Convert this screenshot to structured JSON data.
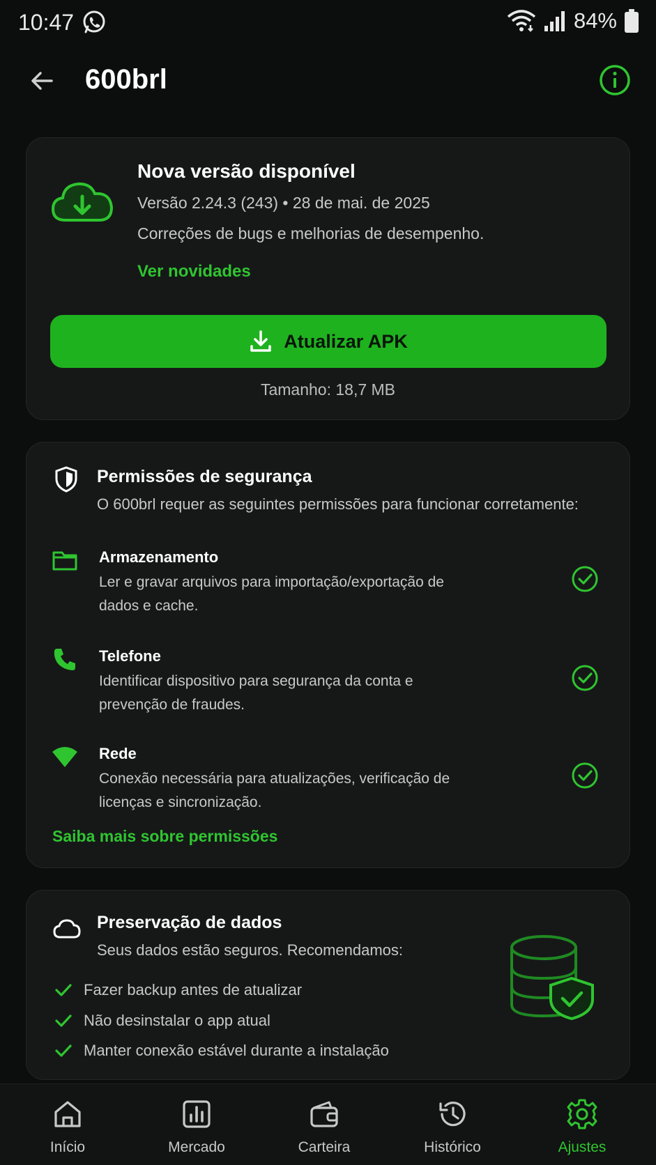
{
  "status_bar": {
    "time": "10:47",
    "battery": "84%"
  },
  "app_bar": {
    "title": "600brl"
  },
  "update_card": {
    "title": "Nova versão disponível",
    "version_line": "Versão 2.24.3 (243) • 28 de mai. de 2025",
    "description": "Correções de bugs e melhorias de desempenho.",
    "link": "Ver novidades",
    "button_label": "Atualizar APK",
    "size": "Tamanho: 18,7 MB"
  },
  "permissions_card": {
    "title": "Permissões de segurança",
    "subtitle": "O 600brl requer as seguintes permissões para funcionar corretamente:",
    "items": [
      {
        "name": "Armazenamento",
        "desc": "Ler e gravar arquivos para importação/exportação de dados e cache.",
        "icon": "folder-icon"
      },
      {
        "name": "Telefone",
        "desc": "Identificar dispositivo para segurança da conta e prevenção de fraudes.",
        "icon": "phone-icon"
      },
      {
        "name": "Rede",
        "desc": "Conexão necessária para atualizações, verificação de licenças e sincronização.",
        "icon": "wifi-icon"
      }
    ],
    "link": "Saiba mais sobre permissões"
  },
  "data_card": {
    "title": "Preservação de dados",
    "subtitle": "Seus dados estão seguros. Recomendamos:",
    "tips": [
      "Fazer backup antes de atualizar",
      "Não desinstalar o app atual",
      "Manter conexão estável durante a instalação"
    ]
  },
  "bottom_nav": {
    "items": [
      {
        "label": "Início",
        "icon": "home-icon"
      },
      {
        "label": "Mercado",
        "icon": "chart-icon"
      },
      {
        "label": "Carteira",
        "icon": "wallet-icon"
      },
      {
        "label": "Histórico",
        "icon": "history-icon"
      },
      {
        "label": "Ajustes",
        "icon": "gear-icon"
      }
    ],
    "active_index": 4
  },
  "colors": {
    "accent": "#2fc530",
    "button": "#1fb21f",
    "background": "#0c0d0d",
    "card": "#161818"
  }
}
